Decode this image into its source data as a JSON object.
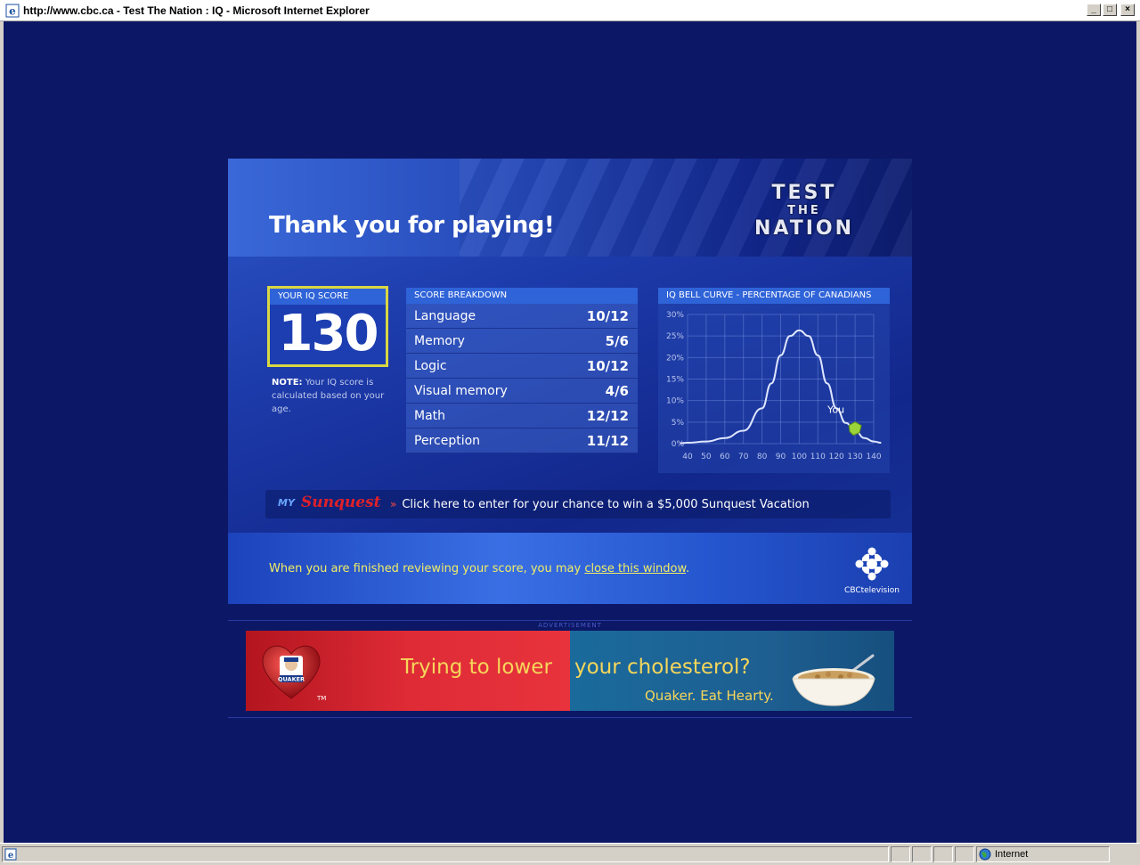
{
  "window": {
    "title": "http://www.cbc.ca - Test The Nation : IQ - Microsoft Internet Explorer",
    "minimize_label": "_",
    "maximize_label": "□",
    "close_label": "×"
  },
  "header": {
    "heading": "Thank you for playing!",
    "logo_line1": "TEST",
    "logo_line2": "THE",
    "logo_line3": "NATION"
  },
  "iq_score": {
    "label": "YOUR IQ SCORE",
    "value": "130",
    "note_bold": "NOTE:",
    "note_text": " Your IQ score is calculated based on your age."
  },
  "breakdown": {
    "label": "SCORE BREAKDOWN",
    "rows": [
      {
        "category": "Language",
        "score": "10/12"
      },
      {
        "category": "Memory",
        "score": "5/6"
      },
      {
        "category": "Logic",
        "score": "10/12"
      },
      {
        "category": "Visual memory",
        "score": "4/6"
      },
      {
        "category": "Math",
        "score": "12/12"
      },
      {
        "category": "Perception",
        "score": "11/12"
      }
    ]
  },
  "chart_data": {
    "type": "line",
    "title": "IQ BELL CURVE - PERCENTAGE OF CANADIANS",
    "x_ticks": [
      40,
      50,
      60,
      70,
      80,
      90,
      100,
      110,
      120,
      130,
      140
    ],
    "y_ticks": [
      "0%",
      "5%",
      "10%",
      "15%",
      "20%",
      "25%",
      "30%"
    ],
    "xlim": [
      40,
      140
    ],
    "ylim": [
      0,
      30
    ],
    "grid": true,
    "series": [
      {
        "x": [
          36,
          40,
          50,
          60,
          70,
          80,
          85,
          90,
          95,
          100,
          105,
          110,
          115,
          120,
          125,
          130,
          135,
          140,
          144
        ],
        "y": [
          0.1,
          0.2,
          0.5,
          1.3,
          3.0,
          8.2,
          14.0,
          20.5,
          25.0,
          26.3,
          25.0,
          20.5,
          14.0,
          8.2,
          4.8,
          3.0,
          1.3,
          0.5,
          0.2
        ]
      }
    ],
    "marker": {
      "label": "You",
      "x": 130,
      "y": 3.6
    }
  },
  "promo": {
    "logo_my": "MY",
    "logo_name": "Sunquest",
    "arrow": "»",
    "text": "Click here to enter for your chance to win a $5,000 Sunquest Vacation"
  },
  "footer": {
    "finish_text": "When you are finished reviewing your score, you may ",
    "finish_link": "close this window",
    "finish_end": ".",
    "cbc_label": "CBCtelevision"
  },
  "advertisement": {
    "label": "ADVERTISEMENT",
    "brand": "QUAKER",
    "tm": "TM",
    "headline_left": "Trying to lower",
    "headline_right": "your cholesterol?",
    "tagline": "Quaker. Eat Hearty."
  },
  "statusbar": {
    "zone": "Internet"
  },
  "colors": {
    "page_bg": "#0c1766",
    "panel_header": "#2f63d8",
    "score_border": "#d9d743",
    "footer_text": "#f1ee64",
    "promo_red": "#e0202a"
  }
}
